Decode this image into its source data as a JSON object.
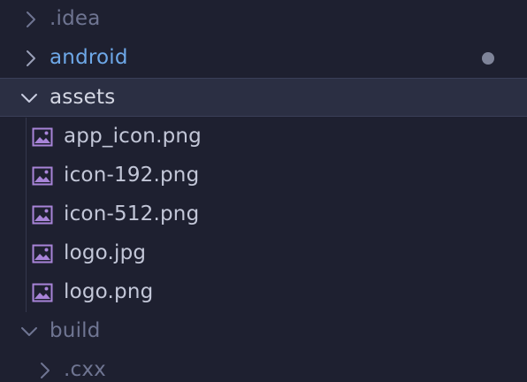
{
  "tree": {
    "items": [
      {
        "label": ".idea",
        "expanded": false,
        "kind": "folder"
      },
      {
        "label": "android",
        "expanded": false,
        "kind": "folder",
        "status": "modified"
      },
      {
        "label": "assets",
        "expanded": true,
        "kind": "folder",
        "selected": true
      },
      {
        "label": "app_icon.png",
        "kind": "image-file"
      },
      {
        "label": "icon-192.png",
        "kind": "image-file"
      },
      {
        "label": "icon-512.png",
        "kind": "image-file"
      },
      {
        "label": "logo.jpg",
        "kind": "image-file"
      },
      {
        "label": "logo.png",
        "kind": "image-file"
      },
      {
        "label": "build",
        "expanded": true,
        "kind": "folder"
      },
      {
        "label": ".cxx",
        "expanded": false,
        "kind": "folder"
      }
    ]
  },
  "colors": {
    "background": "#1e2030",
    "selected_row": "#2b2f43",
    "folder_blue": "#6ea8e8",
    "image_icon": "#a884d8",
    "dim_text": "#6f7592"
  },
  "icons": {
    "collapsed": "chevron-right-icon",
    "expanded": "chevron-down-icon",
    "image_file": "image-file-icon",
    "modified": "modified-dot-icon"
  }
}
